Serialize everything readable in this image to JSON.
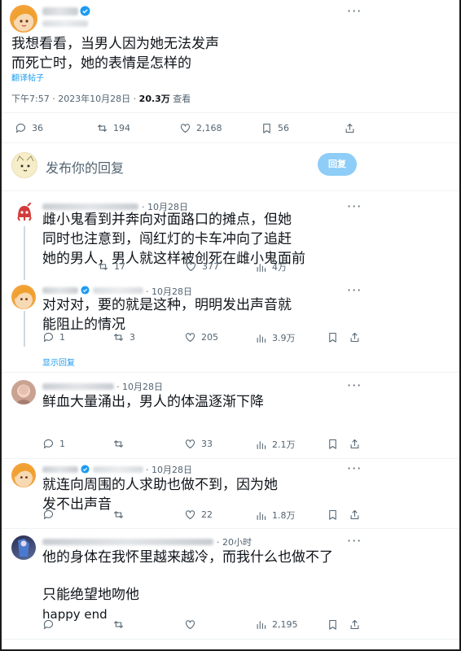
{
  "main_tweet": {
    "text_line1": "我想看看，当男人因为她无法发声",
    "text_line2": "而死亡时，她的表情是怎样的",
    "translate_label": "翻译帖子",
    "time": "下午7:57 · 2023年10月28日 · ",
    "views": "20.3万",
    "views_label": " 查看",
    "replies": "36",
    "retweets": "194",
    "likes": "2,168",
    "bookmarks": "56"
  },
  "composer": {
    "placeholder": "发布你的回复",
    "reply_button": "回复"
  },
  "replies": [
    {
      "date": "· 10月28日",
      "line1": "雌小鬼看到并奔向对面路口的摊点，但她",
      "line2": "同时也注意到，闯红灯的卡车冲向了追赶",
      "line3": "她的男人，男人就这样被创死在雌小鬼面前",
      "replies": "",
      "retweets": "17",
      "likes": "377",
      "views": "4万"
    },
    {
      "date": "· 10月28日",
      "line1": "对对对，要的就是这种，明明发出声音就",
      "line2": "能阻止的情况",
      "replies": "1",
      "retweets": "3",
      "likes": "205",
      "views": "3.9万",
      "show_replies": "显示回复"
    },
    {
      "date": "· 10月28日",
      "line1": "鲜血大量涌出，男人的体温逐渐下降",
      "replies": "1",
      "retweets": "",
      "likes": "33",
      "views": "2.1万"
    },
    {
      "date": "· 10月28日",
      "line1": "就连向周围的人求助也做不到，因为她",
      "line2": "发不出声音",
      "replies": "",
      "retweets": "",
      "likes": "22",
      "views": "1.8万"
    },
    {
      "date": "· 20小时",
      "line1": "他的身体在我怀里越来越冷，而我什么也做不了",
      "line2": "只能绝望地吻他",
      "line3": "happy  end",
      "replies": "",
      "retweets": "",
      "likes": "",
      "views": "2,195"
    }
  ],
  "colors": {
    "accent": "#1d9bf0",
    "reply_button_bg": "#8ecdf7",
    "text": "#0f1419",
    "muted": "#536471"
  }
}
